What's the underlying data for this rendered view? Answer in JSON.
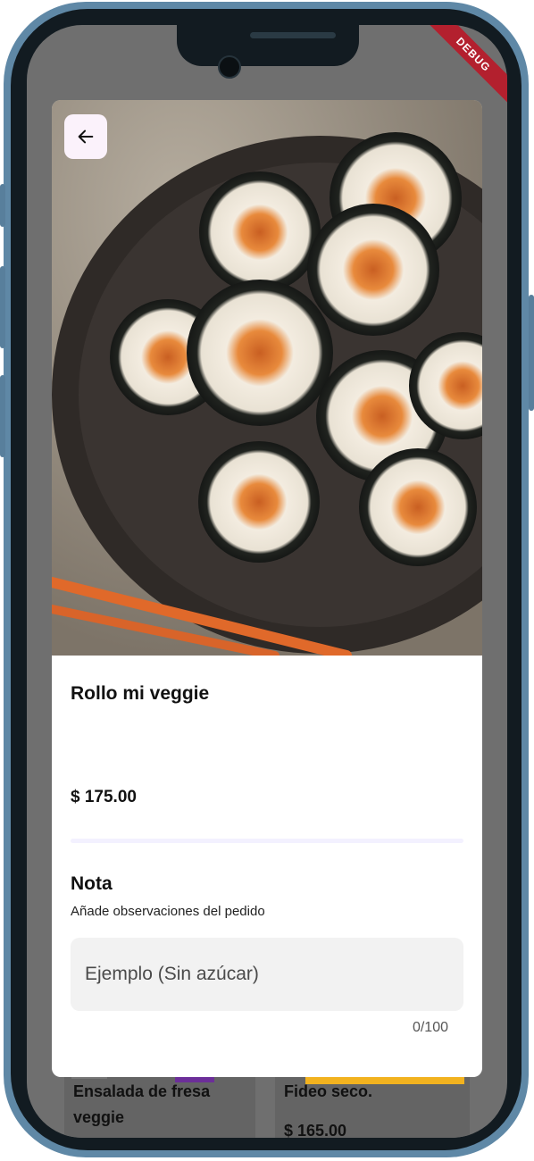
{
  "status_bar": {
    "debug_banner": "DEBUG"
  },
  "product_dialog": {
    "image_icon": "sushi-rolls-photo",
    "back_icon": "arrow-left-icon",
    "name": "Rollo mi veggie",
    "price": "$ 175.00",
    "note": {
      "title": "Nota",
      "subtitle": "Añade observaciones del pedido",
      "placeholder": "Ejemplo (Sin azúcar)",
      "value": "",
      "counter": "0/100"
    }
  },
  "background_menu": {
    "items": [
      {
        "name": "Ensalada  de fresa veggie"
      },
      {
        "name": "Fideo seco.",
        "price": "$ 165.00"
      }
    ]
  },
  "colors": {
    "phone_frame": "#5f88a6",
    "overlay": "#6f6f6f",
    "back_button_bg": "#fbf2fb",
    "input_bg": "#f2f2f2",
    "accent_yellow": "#f2b21f",
    "accent_purple": "#6c2e99",
    "debug_ribbon": "#b3202e"
  }
}
